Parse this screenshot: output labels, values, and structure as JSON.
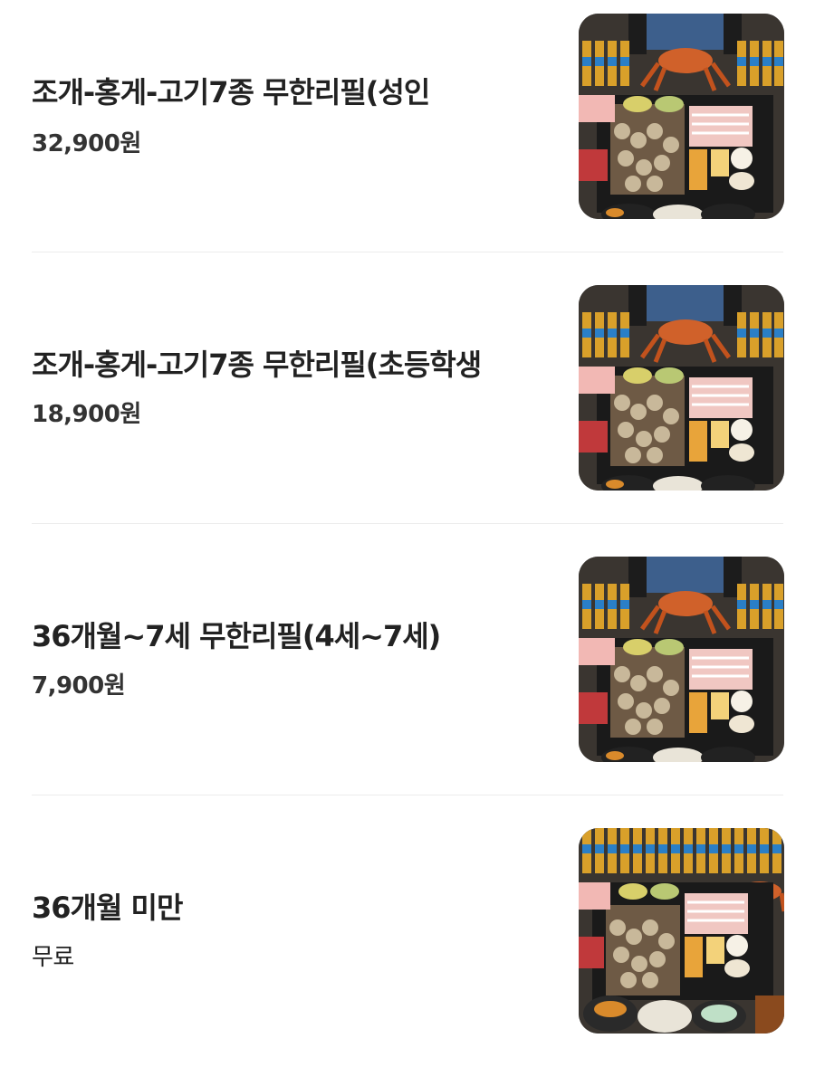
{
  "menu": {
    "items": [
      {
        "name": "조개-홍게-고기7종 무한리필(성인",
        "price": "32,900원",
        "image_alt": "seafood-grill-platter-photo"
      },
      {
        "name": "조개-홍게-고기7종 무한리필(초등학생",
        "price": "18,900원",
        "image_alt": "seafood-grill-platter-photo"
      },
      {
        "name": "36개월~7세 무한리필(4세~7세)",
        "price": "7,900원",
        "image_alt": "seafood-grill-platter-photo"
      },
      {
        "name": "36개월 미만",
        "price": "무료",
        "image_alt": "seafood-grill-platter-photo"
      }
    ]
  },
  "colors": {
    "text_primary": "#222222",
    "divider": "#ececec",
    "background": "#ffffff"
  }
}
